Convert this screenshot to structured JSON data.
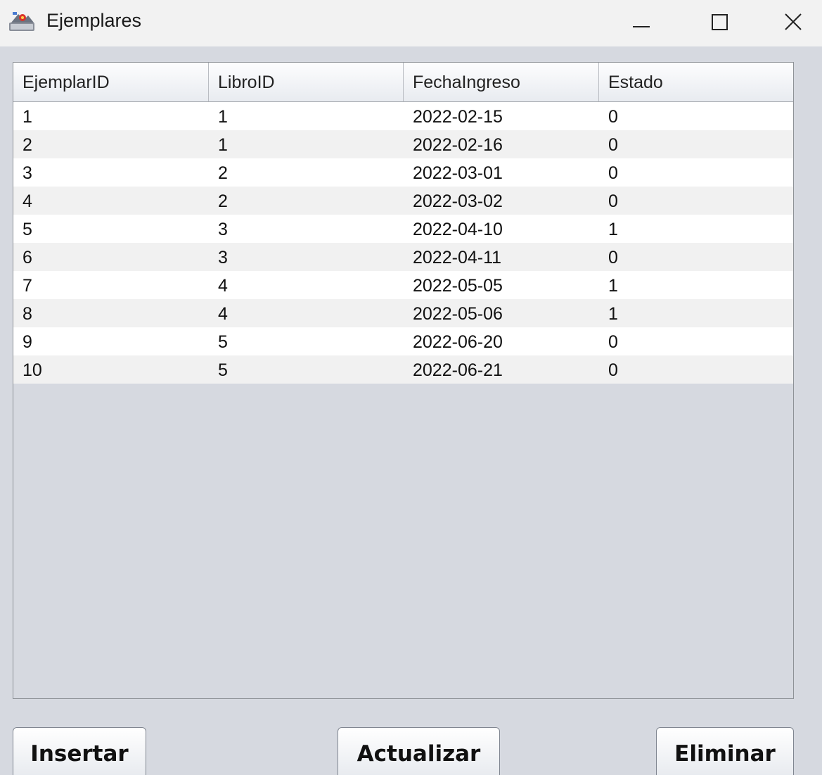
{
  "window": {
    "title": "Ejemplares",
    "icon": "java-app-icon",
    "controls": [
      "minimize-icon",
      "maximize-icon",
      "close-icon"
    ]
  },
  "table": {
    "columns": [
      "EjemplarID",
      "LibroID",
      "FechaIngreso",
      "Estado"
    ],
    "rows": [
      [
        "1",
        "1",
        "2022-02-15",
        "0"
      ],
      [
        "2",
        "1",
        "2022-02-16",
        "0"
      ],
      [
        "3",
        "2",
        "2022-03-01",
        "0"
      ],
      [
        "4",
        "2",
        "2022-03-02",
        "0"
      ],
      [
        "5",
        "3",
        "2022-04-10",
        "1"
      ],
      [
        "6",
        "3",
        "2022-04-11",
        "0"
      ],
      [
        "7",
        "4",
        "2022-05-05",
        "1"
      ],
      [
        "8",
        "4",
        "2022-05-06",
        "1"
      ],
      [
        "9",
        "5",
        "2022-06-20",
        "0"
      ],
      [
        "10",
        "5",
        "2022-06-21",
        "0"
      ]
    ]
  },
  "buttons": {
    "insert": "Insertar",
    "update": "Actualizar",
    "delete": "Eliminar"
  }
}
